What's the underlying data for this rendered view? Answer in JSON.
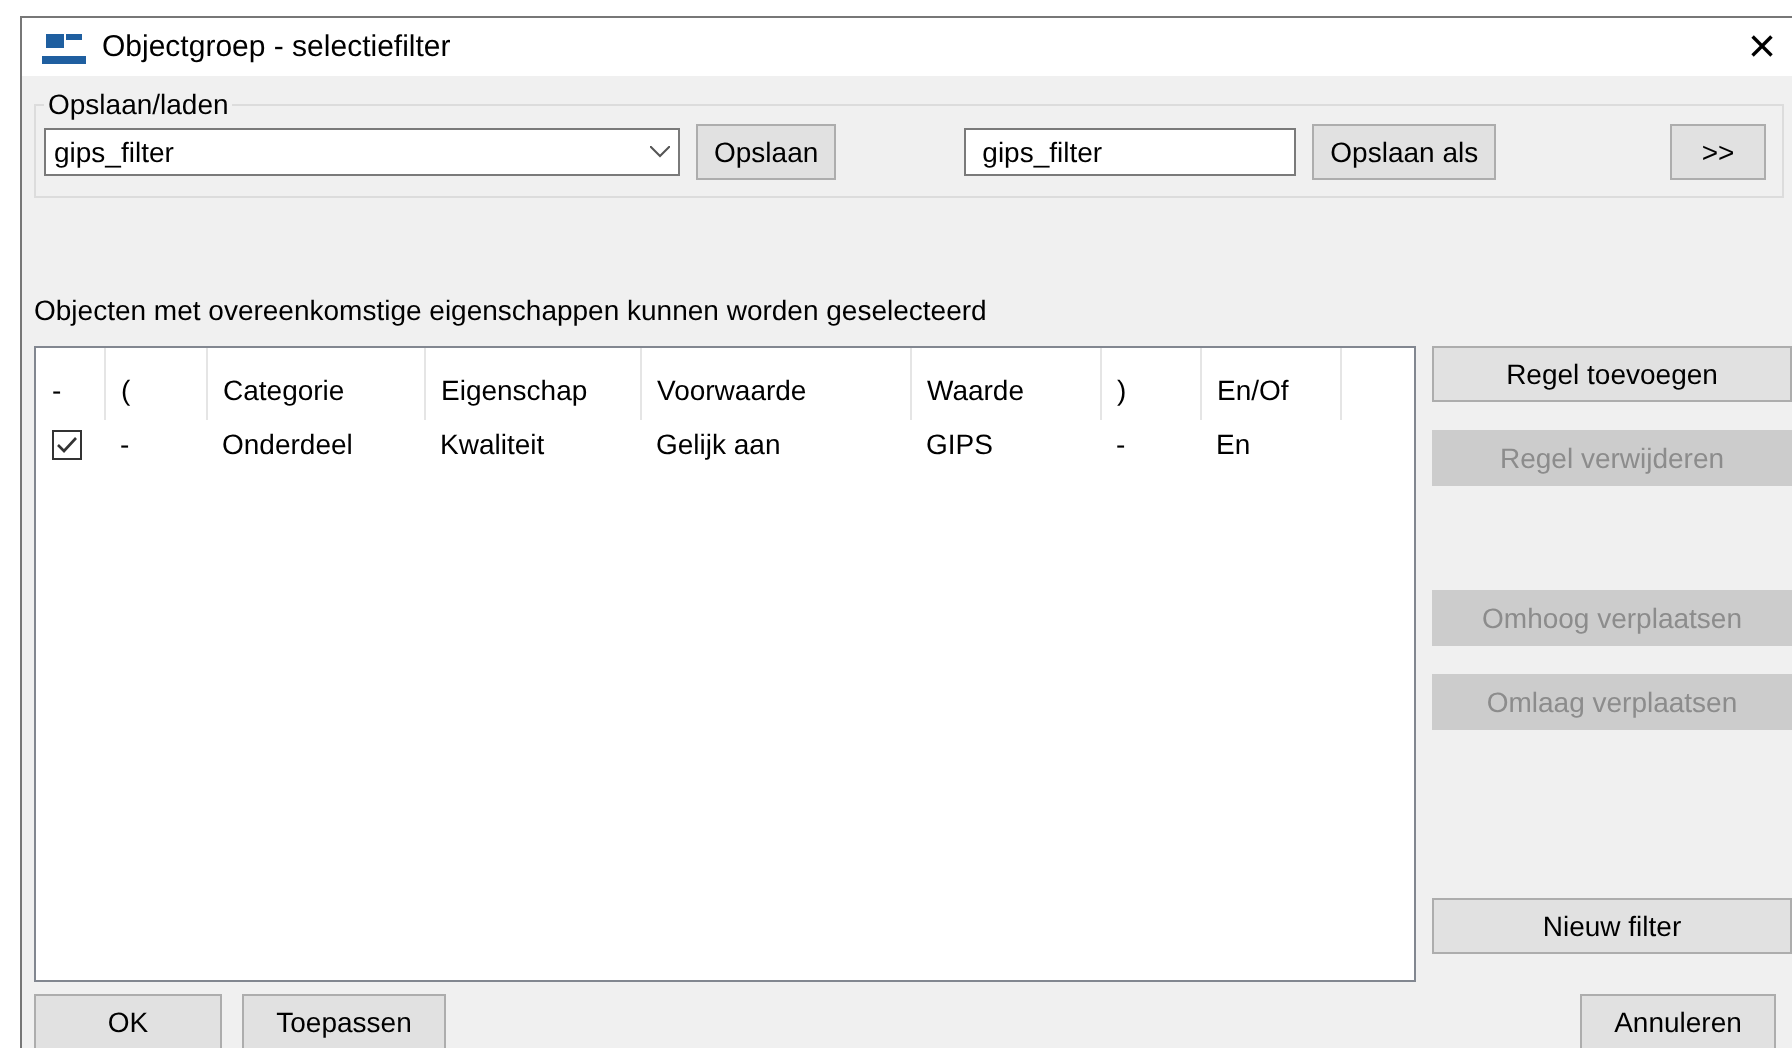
{
  "window": {
    "title": "Objectgroep - selectiefilter",
    "close": "×"
  },
  "save_load": {
    "legend": "Opslaan/laden",
    "filter_select": "gips_filter",
    "save_button": "Opslaan",
    "name_field": "gips_filter",
    "save_as_button": "Opslaan als",
    "more_button": ">>"
  },
  "description": "Objecten met overeenkomstige eigenschappen kunnen worden geselecteerd",
  "table": {
    "columns": [
      "-",
      "(",
      "Categorie",
      "Eigenschap",
      "Voorwaarde",
      "Waarde",
      ")",
      "En/Of"
    ],
    "rows": [
      {
        "cells": [
          {
            "kind": "checkbox",
            "checked": true
          },
          {
            "kind": "text",
            "text": "-"
          },
          {
            "kind": "text",
            "text": "Onderdeel"
          },
          {
            "kind": "text",
            "text": "Kwaliteit"
          },
          {
            "kind": "text",
            "text": "Gelijk aan"
          },
          {
            "kind": "text",
            "text": "GIPS"
          },
          {
            "kind": "text",
            "text": "-"
          },
          {
            "kind": "text",
            "text": "En"
          }
        ]
      }
    ]
  },
  "side_buttons": [
    {
      "label": "Regel toevoegen",
      "disabled": false,
      "kind": "button"
    },
    {
      "label": "Regel verwijderen",
      "disabled": true,
      "kind": "button"
    },
    {
      "kind": "spacer"
    },
    {
      "label": "Omhoog verplaatsen",
      "disabled": true,
      "kind": "button"
    },
    {
      "label": "Omlaag verplaatsen",
      "disabled": true,
      "kind": "button"
    },
    {
      "kind": "spacer"
    },
    {
      "label": "Nieuw filter",
      "disabled": false,
      "kind": "button"
    }
  ],
  "footer": {
    "left": [
      "OK",
      "Toepassen"
    ],
    "right": [
      "Annuleren"
    ]
  }
}
